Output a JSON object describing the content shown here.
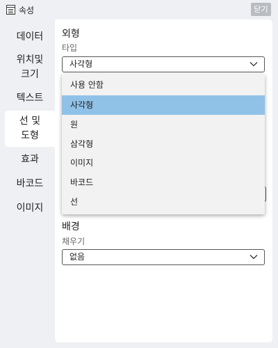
{
  "window": {
    "title": "속성",
    "close_label": "닫기"
  },
  "sidebar": {
    "items": [
      {
        "lines": [
          "데이터"
        ],
        "active": false
      },
      {
        "lines": [
          "위치및",
          "크기"
        ],
        "active": false
      },
      {
        "lines": [
          "텍스트"
        ],
        "active": false
      },
      {
        "lines": [
          "선 및",
          "도형"
        ],
        "active": true
      },
      {
        "lines": [
          "효과"
        ],
        "active": false
      },
      {
        "lines": [
          "바코드"
        ],
        "active": false
      },
      {
        "lines": [
          "이미지"
        ],
        "active": false
      }
    ]
  },
  "panel": {
    "appearance": {
      "heading": "외형",
      "type_label": "타입",
      "type_value": "사각형"
    },
    "background": {
      "heading": "배경",
      "fill_label": "채우기",
      "fill_value": "없음"
    }
  },
  "dropdown": {
    "selected": "사각형",
    "options": [
      "사용 안함",
      "사각형",
      "원",
      "삼각형",
      "이미지",
      "바코드",
      "선"
    ]
  },
  "colors": {
    "window_bg": "#eef0f3",
    "panel_bg": "#ffffff",
    "close_button_bg": "#b9bcc0",
    "dropdown_bg": "#f2f2f2",
    "selected_option_bg": "#90c2e8"
  },
  "icons": {
    "title": "properties-window-icon",
    "select_arrow": "chevron-down-icon"
  }
}
